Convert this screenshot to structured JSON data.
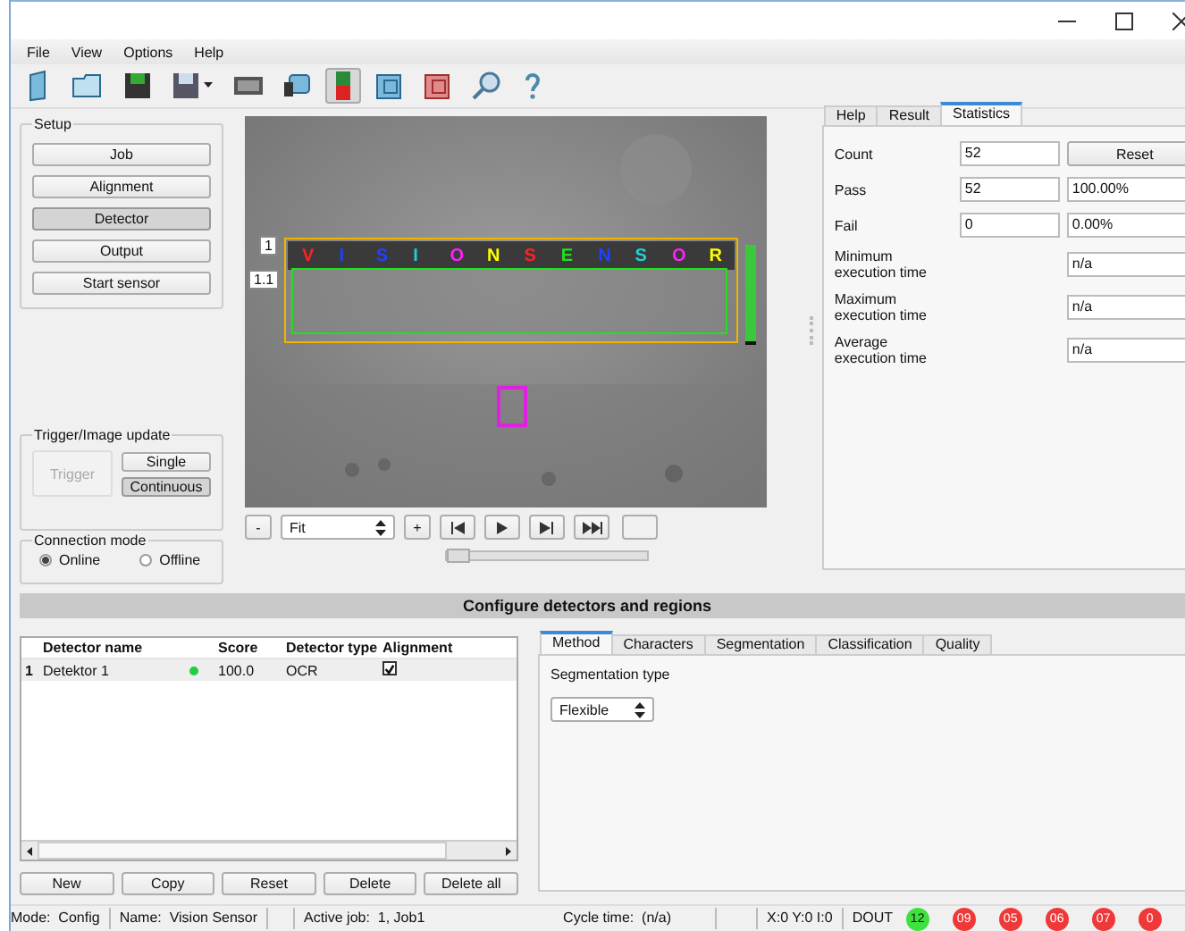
{
  "menu": [
    "File",
    "View",
    "Options",
    "Help"
  ],
  "toolbar": [
    {
      "kind": "page",
      "selected": false
    },
    {
      "kind": "folder",
      "selected": false
    },
    {
      "kind": "save",
      "selected": false
    },
    {
      "kind": "saveas",
      "selected": false
    },
    {
      "kind": "film",
      "selected": false
    },
    {
      "kind": "camera",
      "selected": false
    },
    {
      "kind": "sensor",
      "selected": true
    },
    {
      "kind": "bluebox",
      "selected": false
    },
    {
      "kind": "redbox",
      "selected": false
    },
    {
      "kind": "magnifier",
      "selected": false
    },
    {
      "kind": "help",
      "selected": false
    }
  ],
  "setup": {
    "title": "Setup",
    "buttons": [
      {
        "label": "Job",
        "selected": false
      },
      {
        "label": "Alignment",
        "selected": false
      },
      {
        "label": "Detector",
        "selected": true
      },
      {
        "label": "Output",
        "selected": false
      },
      {
        "label": "Start sensor",
        "selected": false
      }
    ]
  },
  "trigger": {
    "title": "Trigger/Image update",
    "button": {
      "label": "Trigger",
      "disabled": true
    },
    "modes": [
      {
        "label": "Single",
        "selected": false
      },
      {
        "label": "Continuous",
        "selected": true
      }
    ]
  },
  "connection": {
    "title": "Connection mode",
    "options": [
      {
        "label": "Online",
        "selected": true
      },
      {
        "label": "Offline",
        "selected": false
      }
    ]
  },
  "image": {
    "kind": "picture",
    "labels": [
      "1",
      "1.1"
    ],
    "characters": [
      {
        "char": "V",
        "color": "#ff2020"
      },
      {
        "char": "I",
        "color": "#2040ff"
      },
      {
        "char": "S",
        "color": "#2040ff"
      },
      {
        "char": "I",
        "color": "#20d0d0"
      },
      {
        "char": "O",
        "color": "#ff20ff"
      },
      {
        "char": "N",
        "color": "#ffff00"
      },
      {
        "char": "S",
        "color": "#ff2020"
      },
      {
        "char": "E",
        "color": "#20e020"
      },
      {
        "char": "N",
        "color": "#2040ff"
      },
      {
        "char": "S",
        "color": "#20d0d0"
      },
      {
        "char": "O",
        "color": "#ff20ff"
      },
      {
        "char": "R",
        "color": "#ffff00"
      }
    ]
  },
  "viewer": {
    "zoom_out": "-",
    "zoom": "Fit",
    "zoom_in": "+",
    "frame": {
      "level": 0
    }
  },
  "side_tabs": [
    {
      "label": "Help",
      "selected": false
    },
    {
      "label": "Result",
      "selected": false
    },
    {
      "label": "Statistics",
      "selected": true
    }
  ],
  "statistics": [
    {
      "kind": "button",
      "label": "Count",
      "value": "52",
      "action": "Reset"
    },
    {
      "kind": "pair",
      "label": "Pass",
      "value": "52",
      "percent": "100.00%"
    },
    {
      "kind": "pair",
      "label": "Fail",
      "value": "0",
      "percent": "0.00%"
    },
    {
      "kind": "single",
      "label": "Minimum execution time",
      "percent": "n/a"
    },
    {
      "kind": "single",
      "label": "Maximum execution time",
      "percent": "n/a"
    },
    {
      "kind": "single",
      "label": "Average execution time",
      "percent": "n/a"
    }
  ],
  "section_title": "Configure detectors and regions",
  "table": {
    "columns": [
      "Detector name",
      "Score",
      "Detector type",
      "Alignment"
    ],
    "rows": [
      {
        "index": "1",
        "name": "Detektor 1",
        "color": "#22cc44",
        "score": "100.0",
        "type": "OCR",
        "alignment": true
      }
    ]
  },
  "table_buttons": [
    "New",
    "Copy",
    "Reset",
    "Delete",
    "Delete all"
  ],
  "detail_tabs": [
    {
      "label": "Method",
      "selected": true
    },
    {
      "label": "Characters",
      "selected": false
    },
    {
      "label": "Segmentation",
      "selected": false
    },
    {
      "label": "Classification",
      "selected": false
    },
    {
      "label": "Quality",
      "selected": false
    }
  ],
  "segmentation": {
    "label": "Segmentation type",
    "value": "Flexible"
  },
  "status_bar": {
    "mode_label": "Mode:",
    "mode": "Config",
    "name_label": "Name:",
    "name": "Vision Sensor",
    "job_label": "Active job:",
    "job": "1, Job1",
    "cycle_label": "Cycle time:",
    "cycle": "(n/a)",
    "coords": "X:0 Y:0 I:0",
    "dout": "DOUT",
    "leds": [
      {
        "label": "12",
        "on": true
      },
      {
        "label": "09",
        "on": false
      },
      {
        "label": "05",
        "on": false
      },
      {
        "label": "06",
        "on": false
      },
      {
        "label": "07",
        "on": false
      },
      {
        "label": "0",
        "on": false
      }
    ]
  }
}
